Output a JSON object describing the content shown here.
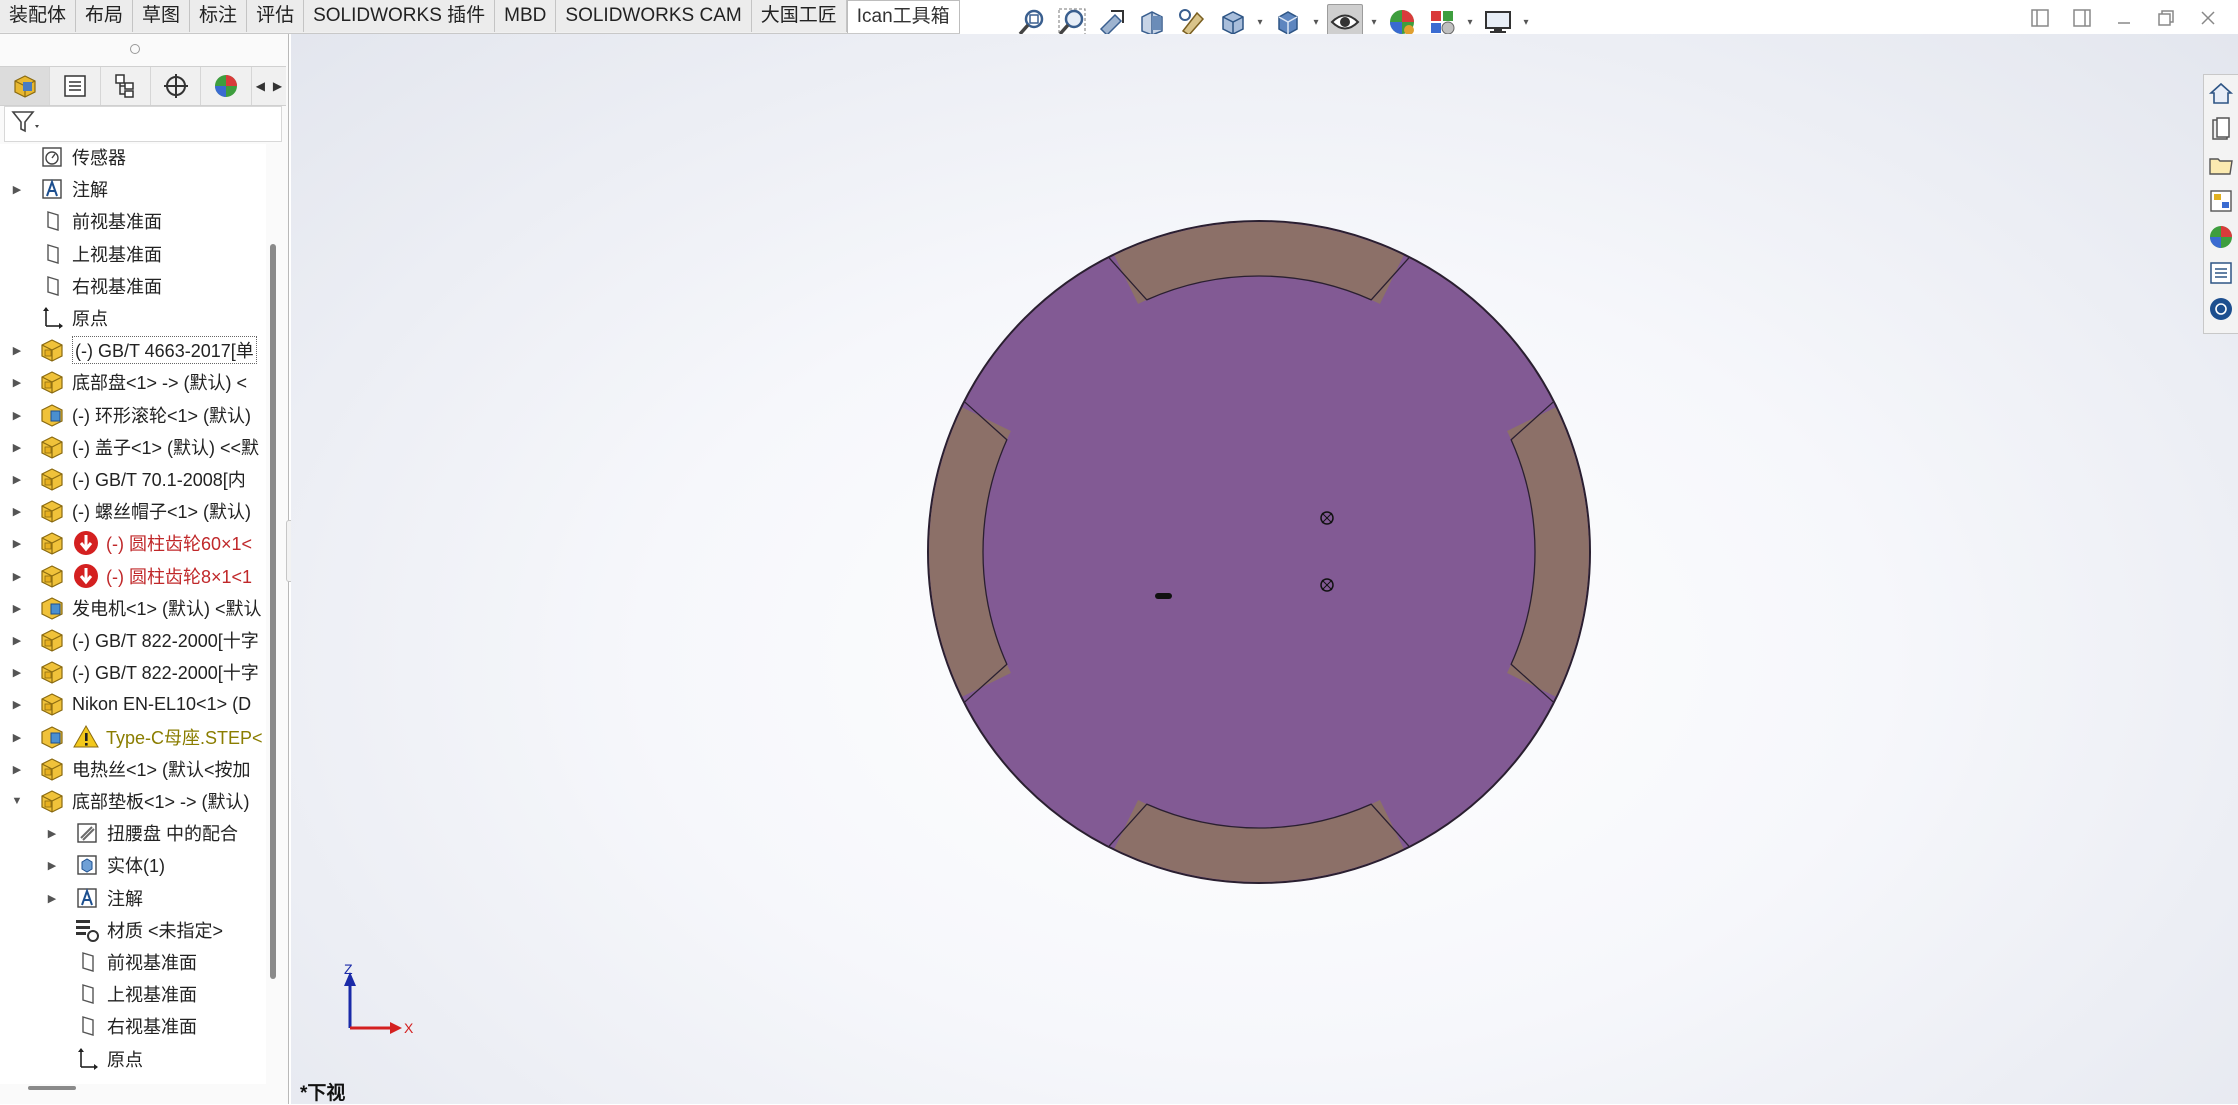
{
  "tabs": [
    "装配体",
    "布局",
    "草图",
    "标注",
    "评估",
    "SOLIDWORKS 插件",
    "MBD",
    "SOLIDWORKS CAM",
    "大国工匠",
    "Ican工具箱"
  ],
  "active_tab_index": 9,
  "hud_icons": [
    "zoom-to-fit-icon",
    "zoom-to-area-icon",
    "previous-view-icon",
    "section-view-icon",
    "dynamic-annotation-icon",
    "view-orientation-icon",
    "display-style-icon",
    "hide-show-items-icon",
    "edit-appearance-icon",
    "apply-scene-icon",
    "view-settings-icon"
  ],
  "tree": {
    "items": [
      {
        "label": "传感器",
        "icon": "sensor-icon",
        "expander": ""
      },
      {
        "label": "注解",
        "icon": "annotation-icon",
        "expander": "▶"
      },
      {
        "label": "前视基准面",
        "icon": "plane-icon",
        "expander": ""
      },
      {
        "label": "上视基准面",
        "icon": "plane-icon",
        "expander": ""
      },
      {
        "label": "右视基准面",
        "icon": "plane-icon",
        "expander": ""
      },
      {
        "label": "原点",
        "icon": "origin-icon",
        "expander": ""
      },
      {
        "label": "(-) GB/T 4663-2017[单",
        "icon": "part-icon",
        "expander": "▶",
        "selected": true
      },
      {
        "label": "底部盘<1> -> (默认) <",
        "icon": "part-icon",
        "expander": "▶"
      },
      {
        "label": "(-) 环形滚轮<1> (默认)",
        "icon": "assembly-icon",
        "expander": "▶"
      },
      {
        "label": "(-) 盖子<1> (默认) <<默",
        "icon": "part-icon",
        "expander": "▶"
      },
      {
        "label": "(-) GB/T 70.1-2008[内",
        "icon": "part-icon",
        "expander": "▶"
      },
      {
        "label": "(-) 螺丝帽子<1> (默认)",
        "icon": "part-icon",
        "expander": "▶"
      },
      {
        "label": "(-) 圆柱齿轮60×1<",
        "icon": "part-icon",
        "expander": "▶",
        "status": "error"
      },
      {
        "label": "(-) 圆柱齿轮8×1<1",
        "icon": "part-icon",
        "expander": "▶",
        "status": "error"
      },
      {
        "label": "发电机<1> (默认) <默认",
        "icon": "assembly-icon",
        "expander": "▶"
      },
      {
        "label": "(-) GB/T 822-2000[十字",
        "icon": "part-icon",
        "expander": "▶"
      },
      {
        "label": "(-) GB/T 822-2000[十字",
        "icon": "part-icon",
        "expander": "▶"
      },
      {
        "label": "Nikon EN-EL10<1> (D",
        "icon": "part-icon",
        "expander": "▶"
      },
      {
        "label": "Type-C母座.STEP<",
        "icon": "assembly-icon",
        "expander": "▶",
        "status": "warning"
      },
      {
        "label": "电热丝<1> (默认<按加",
        "icon": "part-icon",
        "expander": "▶"
      },
      {
        "label": "底部垫板<1> -> (默认)",
        "icon": "part-icon",
        "expander": "▼"
      },
      {
        "label": "扭腰盘 中的配合",
        "icon": "mates-icon",
        "expander": "▶",
        "indent": 1
      },
      {
        "label": "实体(1)",
        "icon": "solid-bodies-icon",
        "expander": "▶",
        "indent": 1
      },
      {
        "label": "注解",
        "icon": "annotation-icon",
        "expander": "▶",
        "indent": 1
      },
      {
        "label": "材质 <未指定>",
        "icon": "material-icon",
        "expander": "",
        "indent": 1
      },
      {
        "label": "前视基准面",
        "icon": "plane-icon",
        "expander": "",
        "indent": 1
      },
      {
        "label": "上视基准面",
        "icon": "plane-icon",
        "expander": "",
        "indent": 1
      },
      {
        "label": "右视基准面",
        "icon": "plane-icon",
        "expander": "",
        "indent": 1
      },
      {
        "label": "原点",
        "icon": "origin-icon",
        "expander": "",
        "indent": 1
      }
    ]
  },
  "view": {
    "label": "*下视",
    "triad_z": "Z",
    "triad_x": "X"
  },
  "colors": {
    "disc": "#825a94",
    "pads": "#8c7068",
    "error": "#c0282a",
    "warning": "#8a7d00"
  }
}
